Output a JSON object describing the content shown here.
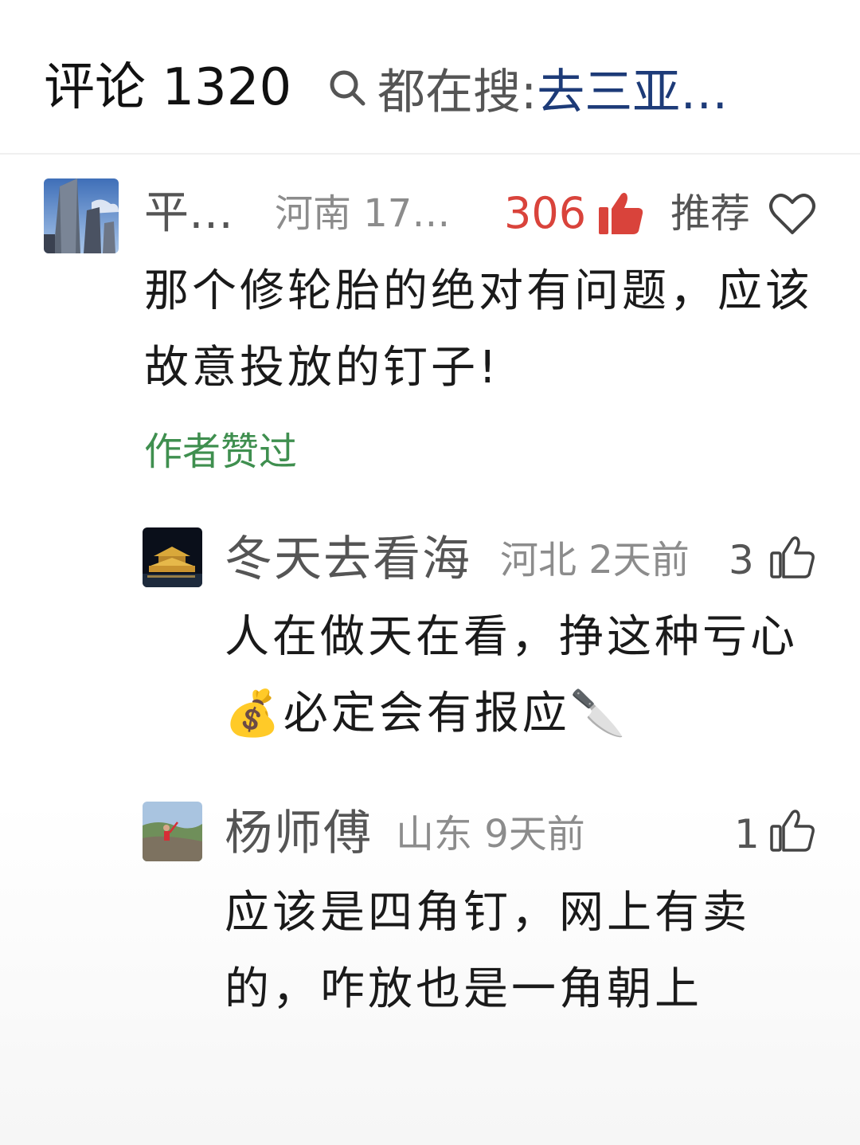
{
  "header": {
    "comments_title": "评论 1320",
    "search_prefix": "都在搜:",
    "search_term": "去三亚…",
    "search_icon": "search-icon"
  },
  "comments": [
    {
      "name": "平…",
      "meta": "河南 17…",
      "likes": "306",
      "recommend_label": "推荐",
      "text": "那个修轮胎的绝对有问题，应该故意投放的钉子!",
      "author_liked": "作者赞过",
      "like_color": "#d9433b"
    }
  ],
  "replies": [
    {
      "name": "冬天去看海",
      "meta": "河北 2天前",
      "likes": "3",
      "text": "人在做天在看，挣这种亏心💰必定会有报应🔪"
    },
    {
      "name": "杨师傅",
      "meta": "山东 9天前",
      "likes": "1",
      "text": "应该是四角钉，网上有卖的，咋放也是一角朝上"
    }
  ]
}
